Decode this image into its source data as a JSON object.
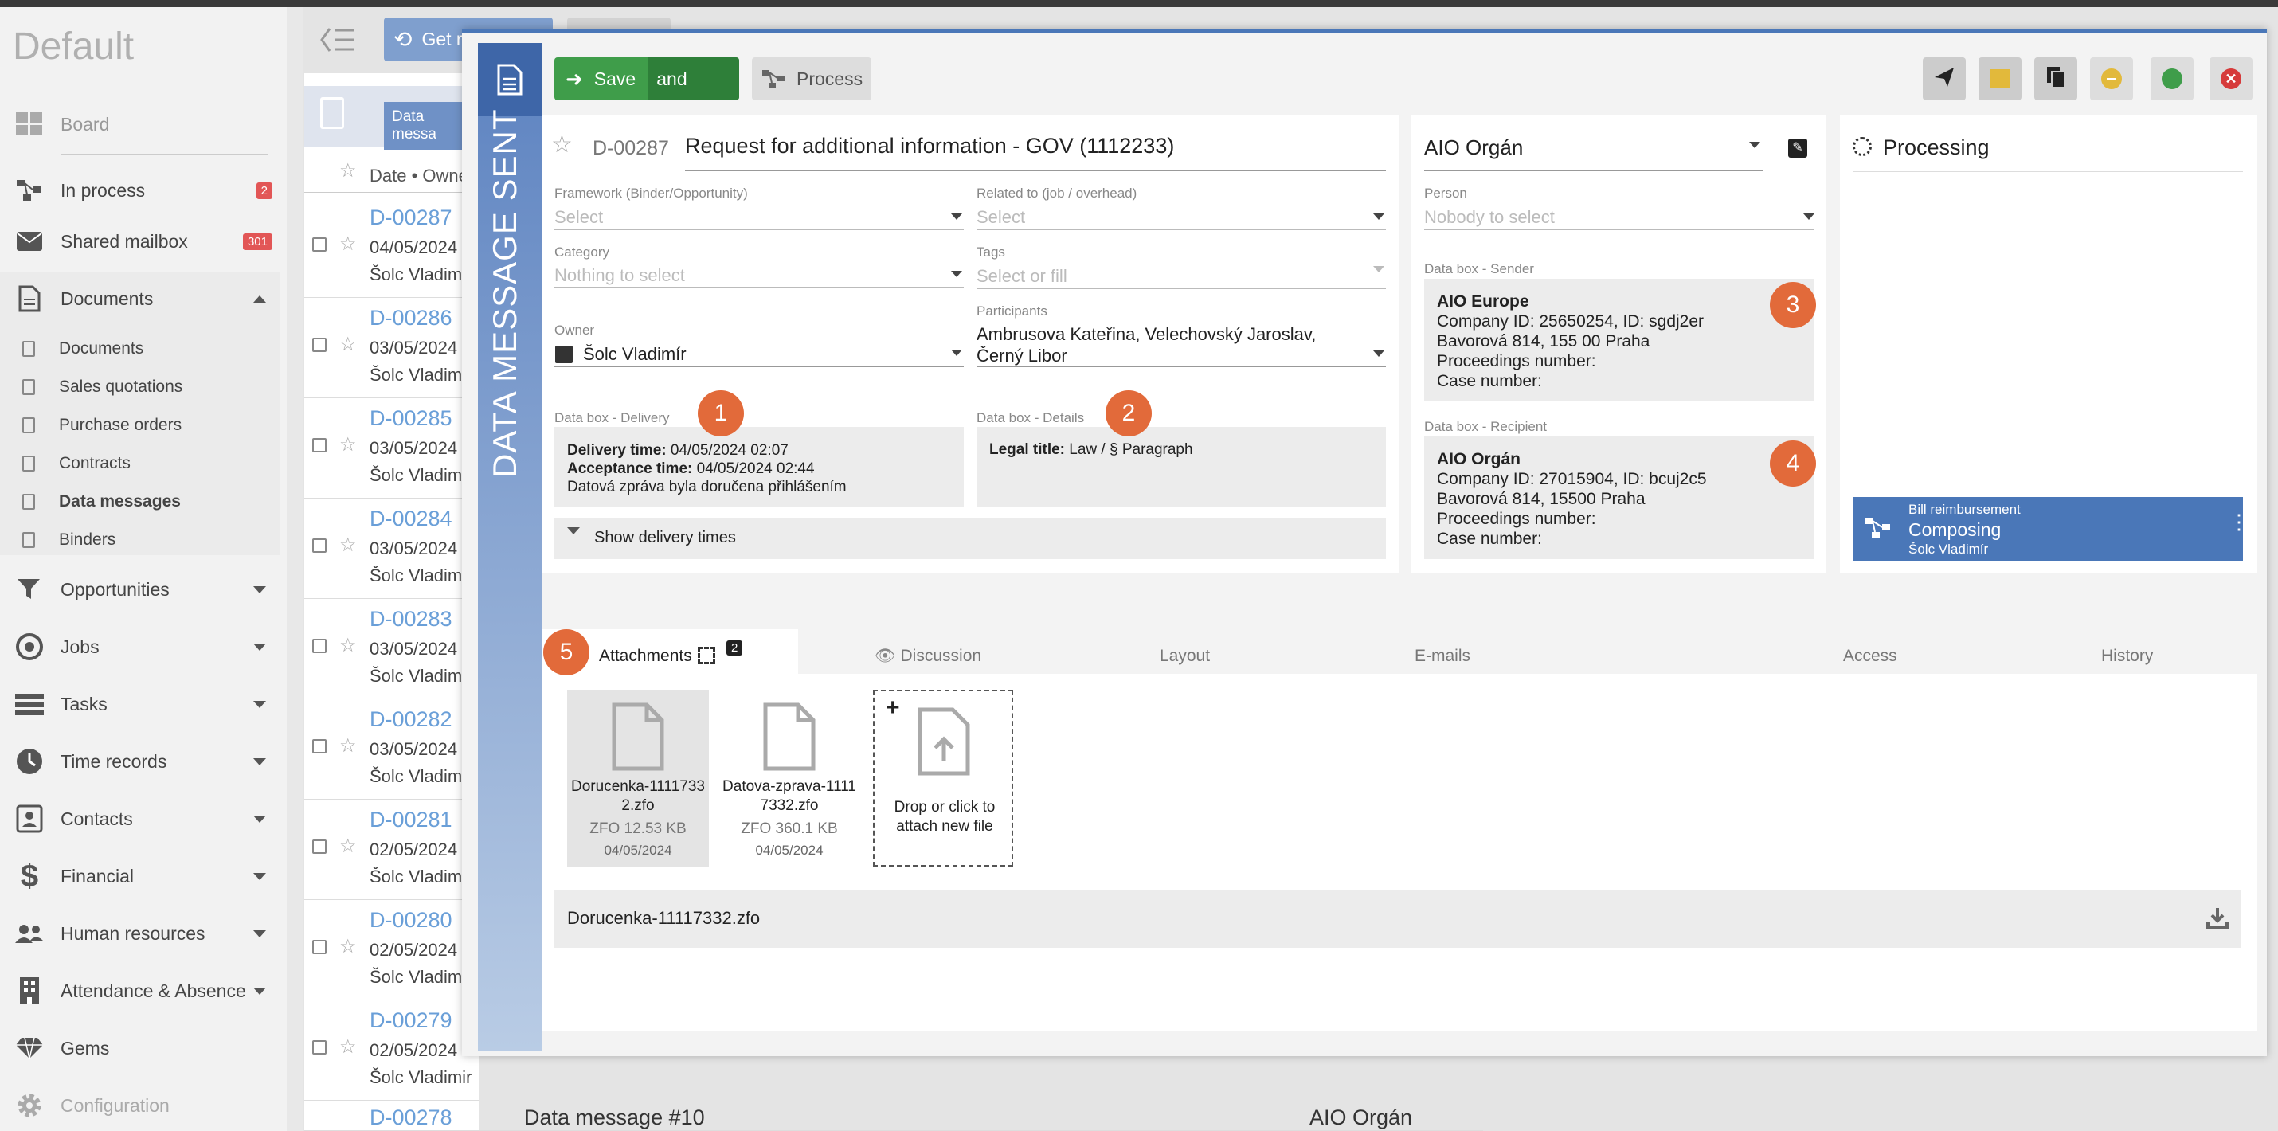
{
  "app": {
    "title": "Default"
  },
  "sidebar": {
    "items": [
      {
        "label": "Board"
      },
      {
        "label": "In process",
        "badge": "2"
      },
      {
        "label": "Shared mailbox",
        "badge": "301"
      },
      {
        "label": "Documents"
      },
      {
        "label": "Opportunities"
      },
      {
        "label": "Jobs"
      },
      {
        "label": "Tasks"
      },
      {
        "label": "Time records"
      },
      {
        "label": "Contacts"
      },
      {
        "label": "Financial"
      },
      {
        "label": "Human resources"
      },
      {
        "label": "Attendance & Absence"
      },
      {
        "label": "Gems"
      },
      {
        "label": "Configuration"
      }
    ],
    "documents_sub": [
      "Documents",
      "Sales quotations",
      "Purchase orders",
      "Contracts",
      "Data messages",
      "Binders"
    ]
  },
  "list": {
    "toolbar_get": "Get r",
    "tab_label": "Data messa",
    "header": "Date • Owne",
    "rows": [
      {
        "id": "D-00287",
        "date": "04/05/2024",
        "owner": "Šolc Vladim"
      },
      {
        "id": "D-00286",
        "date": "03/05/2024",
        "owner": "Šolc Vladim"
      },
      {
        "id": "D-00285",
        "date": "03/05/2024",
        "owner": "Šolc Vladim"
      },
      {
        "id": "D-00284",
        "date": "03/05/2024",
        "owner": "Šolc Vladim"
      },
      {
        "id": "D-00283",
        "date": "03/05/2024",
        "owner": "Šolc Vladim"
      },
      {
        "id": "D-00282",
        "date": "03/05/2024",
        "owner": "Šolc Vladim"
      },
      {
        "id": "D-00281",
        "date": "02/05/2024",
        "owner": "Šolc Vladim"
      },
      {
        "id": "D-00280",
        "date": "02/05/2024",
        "owner": "Šolc Vladim"
      },
      {
        "id": "D-00279",
        "date": "02/05/2024",
        "owner": "Šolc Vladimir"
      }
    ],
    "last_row": {
      "id": "D-00278",
      "subject": "Data message #10",
      "recipient": "AIO Orgán"
    }
  },
  "modal": {
    "stripe_text": "DATA MESSAGE SENT",
    "save": "Save",
    "save_close": "and close",
    "process": "Process",
    "doc_id": "D-00287",
    "subject": "Request for additional information - GOV (1112233)",
    "fields": {
      "framework_label": "Framework (Binder/Opportunity)",
      "framework_ph": "Select",
      "related_label": "Related to (job / overhead)",
      "related_ph": "Select",
      "category_label": "Category",
      "category_ph": "Nothing to select",
      "tags_label": "Tags",
      "tags_ph": "Select or fill",
      "owner_label": "Owner",
      "owner_val": "Šolc Vladimír",
      "participants_label": "Participants",
      "participants_val1": "Ambrusova Kateřina,  Velechovský Jaroslav,",
      "participants_val2": "Černý Libor"
    },
    "delivery": {
      "label": "Data box - Delivery",
      "time_k": "Delivery time:",
      "time_v": "04/05/2024 02:07",
      "accept_k": "Acceptance time:",
      "accept_v": "04/05/2024 02:44",
      "note": "Datová zpráva byla doručena přihlášením",
      "show": "Show delivery times"
    },
    "details": {
      "label": "Data box - Details",
      "k": "Legal title:",
      "v": "Law / § Paragraph"
    },
    "recipient_org": "AIO Orgán",
    "person_label": "Person",
    "person_ph": "Nobody to select",
    "sender": {
      "label": "Data box - Sender",
      "name": "AIO Europe",
      "l1": "Company ID: 25650254, ID: sgdj2er",
      "l2": "Bavorová 814, 155 00 Praha",
      "l3": "Proceedings number:",
      "l4": "Case number:"
    },
    "recipient": {
      "label": "Data box - Recipient",
      "name": "AIO Orgán",
      "l1": "Company ID: 27015904, ID: bcuj2c5",
      "l2": "Bavorová 814, 15500 Praha",
      "l3": "Proceedings number:",
      "l4": "Case number:"
    },
    "processing": {
      "title": "Processing",
      "wf_title": "Bill reimbursement",
      "wf_state": "Composing",
      "wf_user": "Šolc Vladimír"
    },
    "markers": [
      "1",
      "2",
      "3",
      "4",
      "5"
    ],
    "tabs": {
      "attachments": "Attachments",
      "attach_count": "2",
      "discussion": "Discussion",
      "layout": "Layout",
      "emails": "E-mails",
      "access": "Access",
      "history": "History"
    },
    "files": [
      {
        "name": "Dorucenka-11117332.zfo",
        "size": "ZFO 12.53 KB",
        "date": "04/05/2024"
      },
      {
        "name": "Datova-zprava-11117332.zfo",
        "size": "ZFO 360.1 KB",
        "date": "04/05/2024"
      }
    ],
    "drop_plus": "+",
    "drop_text": "Drop or click to attach new file",
    "preview_file": "Dorucenka-11117332.zfo"
  }
}
